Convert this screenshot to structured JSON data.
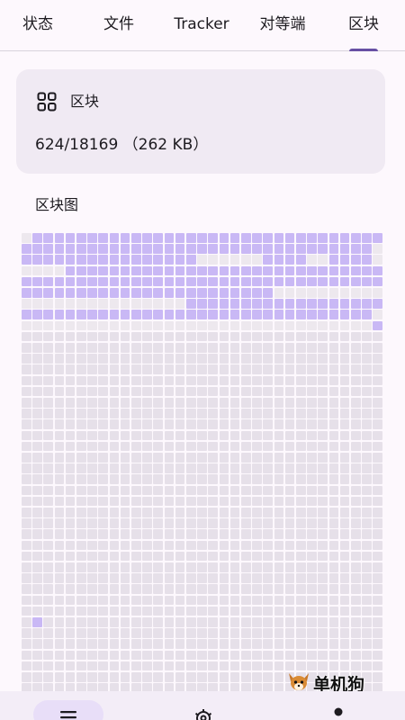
{
  "tabs": [
    {
      "label": "状态",
      "selected": false
    },
    {
      "label": "文件",
      "selected": false
    },
    {
      "label": "Tracker",
      "selected": false
    },
    {
      "label": "对等端",
      "selected": false
    },
    {
      "label": "区块",
      "selected": true
    }
  ],
  "card": {
    "icon": "grid-icon",
    "title": "区块",
    "value": "624/18169 （262 KB）"
  },
  "piece_map": {
    "title": "区块图",
    "columns": 33,
    "rows_shown": 42,
    "colors": {
      "downloaded": "#c9b8f5",
      "missing": "#e6e0e9",
      "partial": "#ede8ee"
    },
    "downloaded_rows": [
      [
        0,
        1,
        1,
        1,
        1,
        1,
        1,
        1,
        1,
        1,
        1,
        1,
        1,
        1,
        1,
        1,
        1,
        1,
        1,
        1,
        1,
        1,
        1,
        1,
        1,
        1,
        1,
        1,
        1,
        1,
        1,
        1,
        1
      ],
      [
        1,
        1,
        1,
        1,
        1,
        1,
        1,
        1,
        1,
        1,
        1,
        1,
        1,
        1,
        1,
        1,
        1,
        1,
        1,
        1,
        1,
        1,
        1,
        1,
        1,
        1,
        1,
        1,
        1,
        1,
        1,
        1,
        0
      ],
      [
        1,
        1,
        1,
        1,
        1,
        1,
        1,
        1,
        1,
        1,
        1,
        1,
        1,
        1,
        1,
        1,
        0,
        0,
        0,
        0,
        0,
        0,
        1,
        1,
        1,
        1,
        0,
        0,
        1,
        1,
        1,
        1,
        0
      ],
      [
        0,
        0,
        0,
        0,
        1,
        1,
        1,
        1,
        1,
        1,
        1,
        1,
        1,
        1,
        1,
        1,
        1,
        1,
        1,
        1,
        1,
        1,
        1,
        1,
        1,
        1,
        1,
        1,
        1,
        1,
        1,
        1,
        1
      ],
      [
        1,
        1,
        1,
        1,
        1,
        1,
        1,
        1,
        1,
        1,
        1,
        1,
        1,
        1,
        1,
        1,
        1,
        1,
        1,
        1,
        1,
        1,
        1,
        1,
        1,
        1,
        1,
        1,
        1,
        1,
        1,
        1,
        1
      ],
      [
        1,
        1,
        1,
        1,
        1,
        1,
        1,
        1,
        1,
        1,
        1,
        1,
        1,
        1,
        1,
        1,
        1,
        1,
        1,
        1,
        1,
        1,
        1,
        0,
        0,
        0,
        0,
        0,
        0,
        0,
        0,
        0,
        0
      ],
      [
        0,
        0,
        0,
        0,
        0,
        0,
        0,
        0,
        0,
        0,
        0,
        0,
        0,
        0,
        0,
        1,
        1,
        1,
        1,
        1,
        1,
        1,
        1,
        1,
        1,
        1,
        1,
        1,
        1,
        1,
        1,
        1,
        1
      ],
      [
        1,
        1,
        1,
        1,
        1,
        1,
        1,
        1,
        1,
        1,
        1,
        1,
        1,
        1,
        1,
        1,
        1,
        1,
        1,
        1,
        1,
        1,
        1,
        1,
        1,
        1,
        1,
        1,
        1,
        1,
        1,
        1,
        0
      ],
      [
        0,
        0,
        0,
        0,
        0,
        0,
        0,
        0,
        0,
        0,
        0,
        0,
        0,
        0,
        0,
        0,
        0,
        0,
        0,
        0,
        0,
        0,
        0,
        0,
        0,
        0,
        0,
        0,
        0,
        0,
        0,
        0,
        1
      ]
    ],
    "extra_downloaded": [
      [
        35,
        1
      ]
    ]
  },
  "bottom_nav": {
    "items": [
      {
        "icon": "list-icon",
        "selected": true
      },
      {
        "icon": "gear-icon",
        "selected": false
      },
      {
        "icon": "person-icon",
        "selected": false
      }
    ]
  },
  "watermark": {
    "text": "单机狗",
    "icon": "fox-mascot-icon"
  }
}
